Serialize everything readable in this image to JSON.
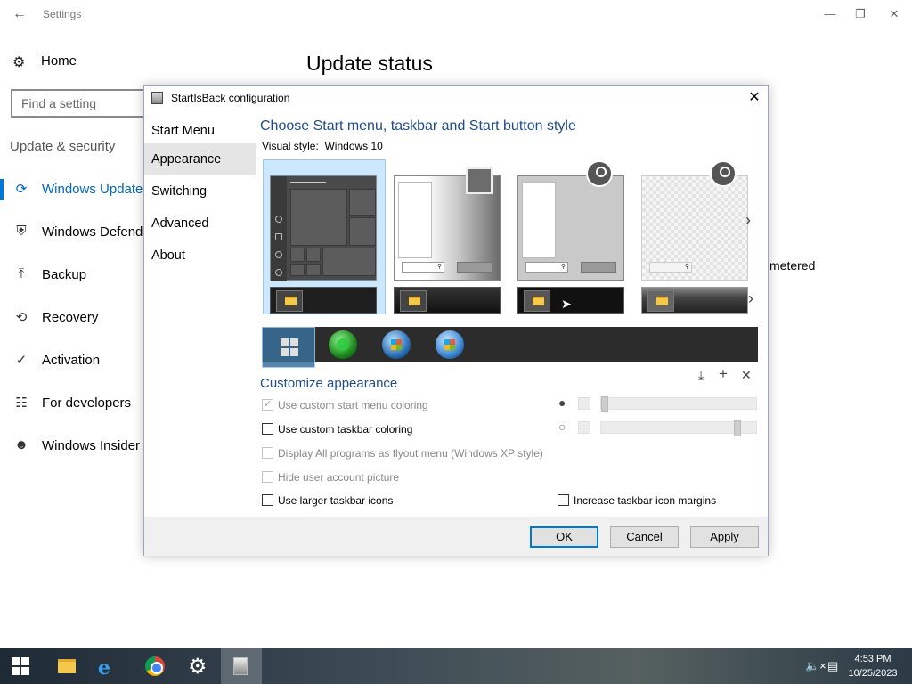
{
  "settings": {
    "title": "Settings",
    "home_label": "Home",
    "search_placeholder": "Find a setting",
    "section_label": "Update & security",
    "heading": "Update status",
    "metered_text": "metered",
    "nav": [
      {
        "label": "Windows Update",
        "icon": "refresh-icon",
        "selected": true
      },
      {
        "label": "Windows Defender",
        "icon": "shield-icon",
        "selected": false
      },
      {
        "label": "Backup",
        "icon": "upload-arrow-icon",
        "selected": false
      },
      {
        "label": "Recovery",
        "icon": "history-icon",
        "selected": false
      },
      {
        "label": "Activation",
        "icon": "checkmark-circle-icon",
        "selected": false
      },
      {
        "label": "For developers",
        "icon": "developer-tools-icon",
        "selected": false
      },
      {
        "label": "Windows Insider Program",
        "icon": "user-badge-icon",
        "selected": false
      }
    ]
  },
  "dialog": {
    "title": "StartIsBack configuration",
    "nav": [
      {
        "label": "Start Menu",
        "selected": false
      },
      {
        "label": "Appearance",
        "selected": true
      },
      {
        "label": "Switching",
        "selected": false
      },
      {
        "label": "Advanced",
        "selected": false
      },
      {
        "label": "About",
        "selected": false
      }
    ],
    "heading": "Choose Start menu, taskbar and Start button style",
    "visual_style_label": "Visual style:",
    "visual_style_value": "Windows 10",
    "selected_start_menu_style": 1,
    "selected_start_button_style": 1,
    "customize_heading": "Customize appearance",
    "options": [
      {
        "label": "Use custom start menu coloring",
        "checked": true,
        "enabled": false
      },
      {
        "label": "Use custom taskbar coloring",
        "checked": false,
        "enabled": true
      },
      {
        "label": "Display All programs as flyout menu (Windows XP style)",
        "checked": false,
        "enabled": false
      },
      {
        "label": "Hide user account picture",
        "checked": false,
        "enabled": false
      },
      {
        "label": "Use larger taskbar icons",
        "checked": false,
        "enabled": true
      },
      {
        "label": "Increase taskbar icon margins",
        "checked": false,
        "enabled": true
      }
    ],
    "sliders": [
      {
        "icon": "drop-filled-icon",
        "value": 0.0
      },
      {
        "icon": "drop-outline-icon",
        "value": 0.9
      }
    ],
    "buttons": {
      "ok": "OK",
      "cancel": "Cancel",
      "apply": "Apply"
    }
  },
  "taskbar": {
    "apps": [
      "start-button",
      "file-explorer",
      "internet-explorer",
      "chrome",
      "settings",
      "startisback"
    ],
    "active_app": "startisback",
    "time": "4:53 PM",
    "date": "10/25/2023"
  }
}
